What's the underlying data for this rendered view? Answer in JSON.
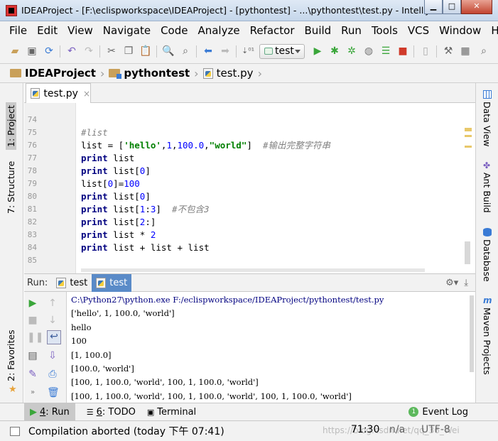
{
  "title": "IDEAProject - [F:\\eclispworkspace\\IDEAProject] - [pythontest] - ...\\pythontest\\test.py - IntelliJ ID...",
  "menu": [
    "File",
    "Edit",
    "View",
    "Navigate",
    "Code",
    "Analyze",
    "Refactor",
    "Build",
    "Run",
    "Tools",
    "VCS",
    "Window",
    "Help"
  ],
  "toolbar": {
    "run_config": "test"
  },
  "breadcrumb": [
    "IDEAProject",
    "pythontest",
    "test.py"
  ],
  "left_tabs": {
    "project": "1: Project",
    "structure": "7: Structure",
    "favorites": "2: Favorites"
  },
  "right_tabs": {
    "data_view": "Data View",
    "ant_build": "Ant Build",
    "database": "Database",
    "maven": "Maven Projects"
  },
  "editor_tab": {
    "label": "test.py",
    "close": "×"
  },
  "editor_lines": [
    {
      "n": "74",
      "code": ""
    },
    {
      "n": "75",
      "code": "#list"
    },
    {
      "n": "76",
      "code": "list = ['hello',1,100.0,\"world\"]  #输出完整字符串"
    },
    {
      "n": "77",
      "code": "print list"
    },
    {
      "n": "78",
      "code": "print list[0]"
    },
    {
      "n": "79",
      "code": "list[0]=100"
    },
    {
      "n": "80",
      "code": "print list[0]"
    },
    {
      "n": "81",
      "code": "print list[1:3]  #不包含3"
    },
    {
      "n": "82",
      "code": "print list[2:]"
    },
    {
      "n": "83",
      "code": "print list * 2"
    },
    {
      "n": "84",
      "code": "print list + list + list"
    },
    {
      "n": "85",
      "code": ""
    }
  ],
  "run": {
    "label": "Run:",
    "tabs": [
      "test",
      "test"
    ],
    "console": [
      "C:\\Python27\\python.exe F:/eclispworkspace/IDEAProject/pythontest/test.py",
      "['hello', 1, 100.0, 'world']",
      "hello",
      "100",
      "[1, 100.0]",
      "[100.0, 'world']",
      "[100, 1, 100.0, 'world', 100, 1, 100.0, 'world']",
      "[100, 1, 100.0, 'world', 100, 1, 100.0, 'world', 100, 1, 100.0, 'world']"
    ]
  },
  "bottom_tabs": {
    "run_num": "4",
    "run_label": ": Run",
    "todo_num": "6",
    "todo_label": ": TODO",
    "terminal": "Terminal",
    "event_log": "Event Log",
    "event_badge": "1"
  },
  "status": {
    "message": "Compilation aborted (today 下午 07:41)",
    "position": "71:30",
    "line_sep": "n/a",
    "encoding": "UTF-8",
    "watermark": "https://blog.csdn.net/qq_36_Wei"
  }
}
